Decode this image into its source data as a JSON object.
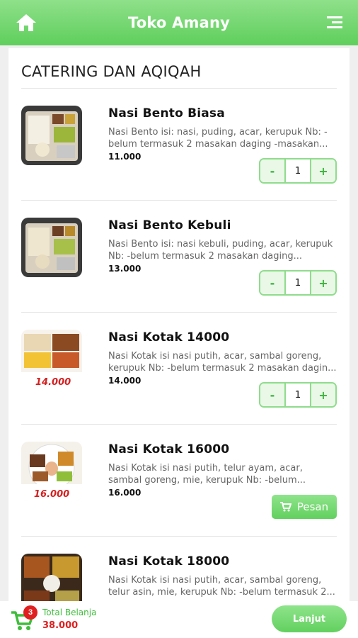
{
  "app": {
    "title": "Toko Amany",
    "accent": "#62d05f",
    "home_icon": "home-icon",
    "menu_icon": "menu-icon"
  },
  "section": {
    "title": "CATERING DAN AQIQAH"
  },
  "items": [
    {
      "name": "Nasi Bento Biasa",
      "desc": "Nasi Bento isi: nasi, puding, acar, kerupuk Nb: -belum termasuk 2 masakan daging -masakan...",
      "price": "11.000",
      "qty": "1",
      "minus": "-",
      "plus": "+"
    },
    {
      "name": "Nasi Bento Kebuli",
      "desc": "Nasi Bento isi: nasi kebuli, puding, acar, kerupuk Nb: -belum termasuk 2 masakan daging...",
      "price": "13.000",
      "qty": "1",
      "minus": "-",
      "plus": "+"
    },
    {
      "name": "Nasi Kotak 14000",
      "desc": "Nasi Kotak isi nasi putih, acar, sambal goreng, kerupuk Nb: -belum termasuk 2 masakan dagin...",
      "price": "14.000",
      "qty": "1",
      "minus": "-",
      "plus": "+",
      "thumb_label": "14.000"
    },
    {
      "name": "Nasi Kotak 16000",
      "desc": "Nasi Kotak isi nasi putih, telur ayam, acar, sambal goreng, mie, kerupuk Nb: -belum...",
      "price": "16.000",
      "order_label": "Pesan",
      "thumb_label": "16.000"
    },
    {
      "name": "Nasi Kotak 18000",
      "desc": "Nasi Kotak isi nasi putih, acar, sambal goreng, telur asin, mie, kerupuk Nb: -belum termasuk 2...",
      "price": ""
    }
  ],
  "footer": {
    "cart_count": "3",
    "total_label": "Total Belanja",
    "total_value": "38.000",
    "next_label": "Lanjut"
  }
}
